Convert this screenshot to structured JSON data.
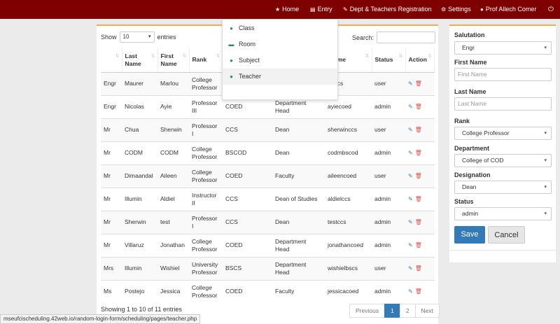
{
  "navbar": {
    "items": [
      {
        "icon": "star-icon",
        "glyph": "★",
        "label": "Home"
      },
      {
        "icon": "file-icon",
        "glyph": "▤",
        "label": "Entry"
      },
      {
        "icon": "wrench-icon",
        "glyph": "✎",
        "label": "Dept  & Teachers Registration"
      },
      {
        "icon": "gear-icon",
        "glyph": "⚙",
        "label": "Settings"
      },
      {
        "icon": "user-icon",
        "glyph": "●",
        "label": "Prof Allech Comer"
      },
      {
        "icon": "power-icon",
        "glyph": "⏻",
        "label": ""
      }
    ]
  },
  "entry_menu": {
    "items": [
      {
        "icon": "user-icon",
        "glyph": "●",
        "label": "Class"
      },
      {
        "icon": "room-icon",
        "glyph": "▬",
        "label": "Room"
      },
      {
        "icon": "user-icon",
        "glyph": "●",
        "label": "Subject"
      },
      {
        "icon": "user-icon",
        "glyph": "●",
        "label": "Teacher"
      }
    ]
  },
  "table_controls": {
    "show_label": "Show",
    "page_size": "10",
    "entries_label": "entries",
    "search_label": "Search:"
  },
  "table": {
    "columns": [
      "",
      "Last Name",
      "First Name",
      "Rank",
      "",
      "",
      "rname",
      "Status",
      "Action"
    ],
    "rows": [
      {
        "sal": "Engr",
        "last": "Maurer",
        "first": "Marlou",
        "rank": "College Professor",
        "dept": "",
        "desig": "",
        "user": "ouccs",
        "status": "user"
      },
      {
        "sal": "Engr",
        "last": "Nicolas",
        "first": "Ayie",
        "rank": "Professor III",
        "dept": "COED",
        "desig": "Department Head",
        "user": "ayiecoed",
        "status": "admin"
      },
      {
        "sal": "Mr",
        "last": "Chua",
        "first": "Sherwin",
        "rank": "Professor I",
        "dept": "CCS",
        "desig": "Dean",
        "user": "sherwinccs",
        "status": "user"
      },
      {
        "sal": "Mr",
        "last": "CODM",
        "first": "CODM",
        "rank": "College Professor",
        "dept": "BSCOD",
        "desig": "Dean",
        "user": "codmbscod",
        "status": "admin"
      },
      {
        "sal": "Mr",
        "last": "Dimaandal",
        "first": "Aileen",
        "rank": "College Professor",
        "dept": "COED",
        "desig": "Faculty",
        "user": "aileencoed",
        "status": "user"
      },
      {
        "sal": "Mr",
        "last": "Illumin",
        "first": "Aldiel",
        "rank": "Instructor II",
        "dept": "CCS",
        "desig": "Dean of Studies",
        "user": "aldielccs",
        "status": "admin"
      },
      {
        "sal": "Mr",
        "last": "Sherwin",
        "first": "test",
        "rank": "Professor I",
        "dept": "CCS",
        "desig": "Dean",
        "user": "testccs",
        "status": "admin"
      },
      {
        "sal": "Mr",
        "last": "Villaruz",
        "first": "Jonathan",
        "rank": "College Professor",
        "dept": "COED",
        "desig": "Department Head",
        "user": "jonathancoed",
        "status": "admin"
      },
      {
        "sal": "Mrs",
        "last": "Illumin",
        "first": "Wishiel",
        "rank": "University Professor",
        "dept": "BSCS",
        "desig": "Department Head",
        "user": "wishielbscs",
        "status": "user"
      },
      {
        "sal": "Ms",
        "last": "Postejo",
        "first": "Jessica",
        "rank": "College Professor",
        "dept": "COED",
        "desig": "Faculty",
        "user": "jessicacoed",
        "status": "admin"
      }
    ]
  },
  "footer": {
    "showing": "Showing 1 to 10 of 11 entries",
    "pagination": [
      "Previous",
      "1",
      "2",
      "Next"
    ]
  },
  "form": {
    "salutation_label": "Salutation",
    "salutation_value": "Engr",
    "firstname_label": "First Name",
    "firstname_placeholder": "First Name",
    "lastname_label": "Last Name",
    "lastname_placeholder": "Last Name",
    "rank_label": "Rank",
    "rank_value": "College Professor",
    "department_label": "Department",
    "department_value": "College of COD",
    "designation_label": "Designation",
    "designation_value": "Dean",
    "status_label": "Status",
    "status_value": "admin",
    "save_label": "Save",
    "cancel_label": "Cancel"
  },
  "statusbar": {
    "url": "mseufcischeduling.42web.io/random-login-form/scheduling/pages/teacher.php"
  },
  "colors": {
    "navbar": "#7f0000",
    "accent": "#f0ad4e",
    "primary": "#337ab7",
    "danger": "#d9534f"
  }
}
